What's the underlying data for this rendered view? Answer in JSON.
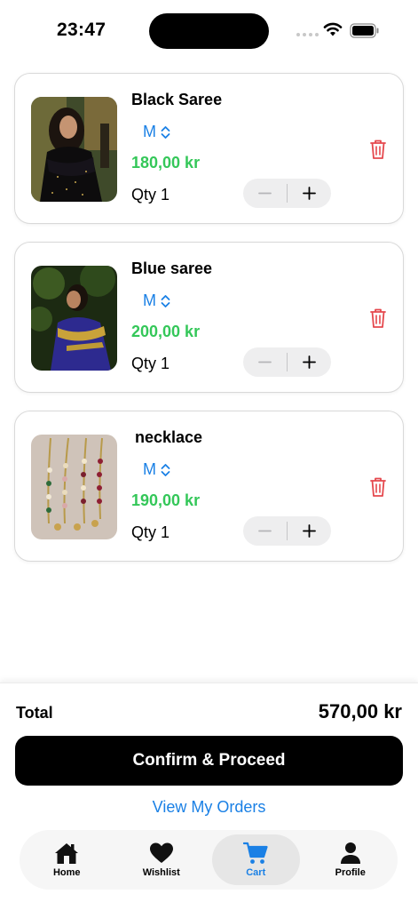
{
  "status_bar": {
    "time": "23:47"
  },
  "cart": {
    "items": [
      {
        "name": "Black Saree",
        "size": "M",
        "price": "180,00 kr",
        "qty": "Qty 1",
        "image": "black-saree-photo"
      },
      {
        "name": "Blue saree",
        "size": "M",
        "price": "200,00 kr",
        "qty": "Qty 1",
        "image": "blue-saree-photo"
      },
      {
        "name": "necklace",
        "size": "M",
        "price": "190,00 kr",
        "qty": "Qty 1",
        "image": "necklace-photo"
      }
    ]
  },
  "summary": {
    "total_label": "Total",
    "total_value": "570,00 kr",
    "confirm_label": "Confirm & Proceed",
    "orders_link": "View My Orders"
  },
  "tab_bar": {
    "tabs": [
      {
        "label": "Home",
        "icon": "house-icon",
        "active": false
      },
      {
        "label": "Wishlist",
        "icon": "heart-icon",
        "active": false
      },
      {
        "label": "Cart",
        "icon": "cart-icon",
        "active": true
      },
      {
        "label": "Profile",
        "icon": "person-icon",
        "active": false
      }
    ]
  },
  "colors": {
    "accent": "#1a80e5",
    "price": "#34c759",
    "delete": "#e5484d",
    "primary_button": "#000000"
  }
}
